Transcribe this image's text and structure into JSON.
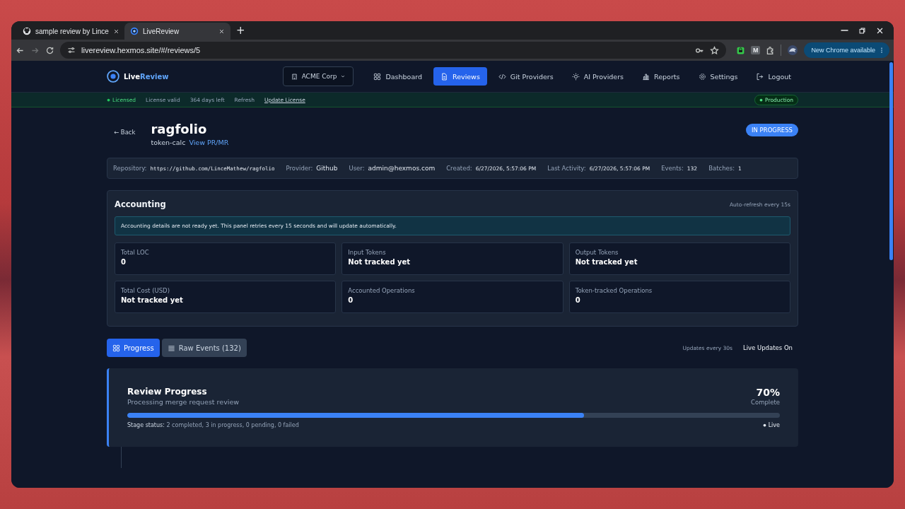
{
  "browser": {
    "tabs": [
      {
        "title": "sample review by Lince",
        "kind": "github",
        "selected": false
      },
      {
        "title": "LiveReview",
        "kind": "site",
        "selected": true
      }
    ],
    "new_tab": "+",
    "url": "livereview.hexmos.site/#/reviews/5",
    "extension_letter": "M",
    "update_button": "New Chrome available"
  },
  "app": {
    "logo": {
      "first": "Live",
      "second": "Review"
    },
    "org": "ACME Corp",
    "nav": [
      {
        "label": "Dashboard",
        "kind": "grid",
        "selected": false
      },
      {
        "label": "Reviews",
        "kind": "doc",
        "selected": true
      },
      {
        "label": "Git Providers",
        "kind": "code",
        "selected": false
      },
      {
        "label": "AI Providers",
        "kind": "bulb",
        "selected": false
      },
      {
        "label": "Reports",
        "kind": "bars",
        "selected": false
      },
      {
        "label": "Settings",
        "kind": "gear",
        "selected": false
      },
      {
        "label": "Logout",
        "kind": "logout",
        "selected": false
      }
    ]
  },
  "license": {
    "status": "Licensed",
    "valid": "License valid",
    "days": "364 days left",
    "refresh": "Refresh",
    "link": "Update License",
    "environment": "Production"
  },
  "review": {
    "back": "← Back",
    "title": "ragfolio",
    "branch": "token-calc",
    "link": "View PR/MR",
    "status": "IN PROGRESS"
  },
  "meta": [
    {
      "label": "Repository:",
      "value": "https://github.com/LinceMathew/ragfolio",
      "kind": "mono"
    },
    {
      "label": "Provider:",
      "value": "Github",
      "kind": "normal"
    },
    {
      "label": "User:",
      "value": "admin@hexmos.com",
      "kind": "normal"
    },
    {
      "label": "Created:",
      "value": "6/27/2026, 5:57:06 PM",
      "kind": "small"
    },
    {
      "label": "Last Activity:",
      "value": "6/27/2026, 5:57:06 PM",
      "kind": "small"
    },
    {
      "label": "Events:",
      "value": "132",
      "kind": "small"
    },
    {
      "label": "Batches:",
      "value": "1",
      "kind": "small"
    }
  ],
  "accounting": {
    "title": "Accounting",
    "refresh": "Auto-refresh every 15s",
    "notice": "Accounting details are not ready yet. This panel retries every 15 seconds and will update automatically.",
    "metrics": [
      {
        "label": "Total LOC",
        "value": "0"
      },
      {
        "label": "Input Tokens",
        "value": "Not tracked yet"
      },
      {
        "label": "Output Tokens",
        "value": "Not tracked yet"
      },
      {
        "label": "Total Cost (USD)",
        "value": "Not tracked yet"
      },
      {
        "label": "Accounted Operations",
        "value": "0"
      },
      {
        "label": "Token-tracked Operations",
        "value": "0"
      }
    ]
  },
  "view_tabs": [
    {
      "label": "Progress",
      "kind": "grid",
      "selected": true
    },
    {
      "label": "Raw Events (132)",
      "kind": "list",
      "selected": false
    }
  ],
  "updates": {
    "interval": "Updates every 30s",
    "live": "Live Updates On"
  },
  "progress": {
    "title": "Review Progress",
    "subtitle": "Processing merge request review",
    "percent": "70%",
    "percent_label": "Complete",
    "level": 0.7,
    "stage_label": "Stage status:",
    "stage_text": "2 completed, 3 in progress, 0 pending, 0 failed",
    "live": "Live"
  }
}
